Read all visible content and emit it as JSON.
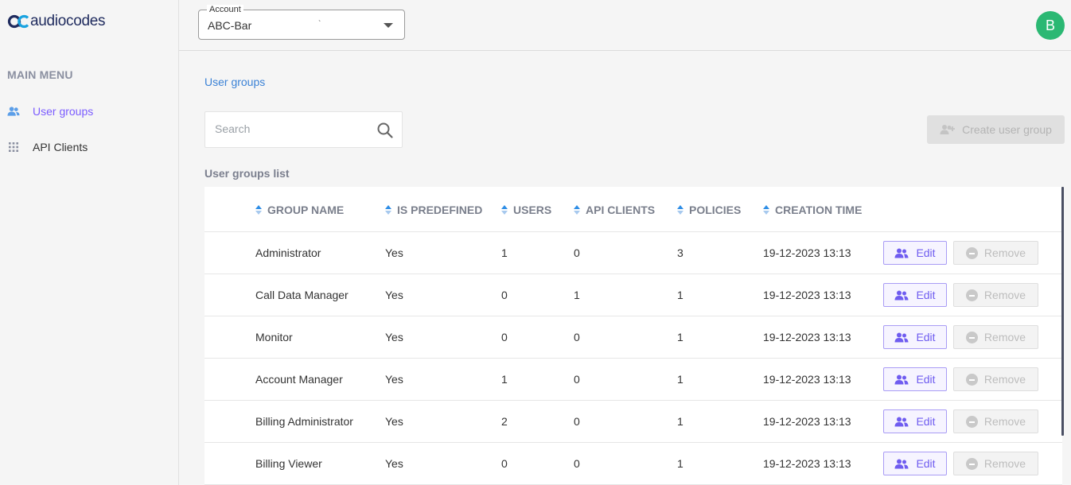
{
  "brand": {
    "name": "audiocodes"
  },
  "sidebar": {
    "menu_title": "MAIN MENU",
    "items": [
      {
        "label": "User groups",
        "icon": "users-icon",
        "active": true
      },
      {
        "label": "API Clients",
        "icon": "grid-icon",
        "active": false
      }
    ]
  },
  "topbar": {
    "account_label": "Account",
    "account_value": "ABC-Bar",
    "account_tick": "`",
    "avatar_initial": "B",
    "avatar_color": "#2bb873"
  },
  "main": {
    "breadcrumb": "User groups",
    "search_placeholder": "Search",
    "create_button": "Create user group",
    "list_title": "User groups list",
    "columns": [
      "GROUP NAME",
      "IS PREDEFINED",
      "USERS",
      "API CLIENTS",
      "POLICIES",
      "CREATION TIME"
    ],
    "edit_label": "Edit",
    "remove_label": "Remove",
    "rows": [
      {
        "name": "Administrator",
        "predefined": "Yes",
        "users": "1",
        "api_clients": "0",
        "policies": "3",
        "created": "19-12-2023 13:13"
      },
      {
        "name": "Call Data Manager",
        "predefined": "Yes",
        "users": "0",
        "api_clients": "1",
        "policies": "1",
        "created": "19-12-2023 13:13"
      },
      {
        "name": "Monitor",
        "predefined": "Yes",
        "users": "0",
        "api_clients": "0",
        "policies": "1",
        "created": "19-12-2023 13:13"
      },
      {
        "name": "Account Manager",
        "predefined": "Yes",
        "users": "1",
        "api_clients": "0",
        "policies": "1",
        "created": "19-12-2023 13:13"
      },
      {
        "name": "Billing Administrator",
        "predefined": "Yes",
        "users": "2",
        "api_clients": "0",
        "policies": "1",
        "created": "19-12-2023 13:13"
      },
      {
        "name": "Billing Viewer",
        "predefined": "Yes",
        "users": "0",
        "api_clients": "0",
        "policies": "1",
        "created": "19-12-2023 13:13"
      }
    ]
  },
  "colors": {
    "accent": "#7b5cff",
    "link": "#3b82d6",
    "brand_navy": "#1f2b5e",
    "brand_cyan": "#1aa3e0"
  }
}
